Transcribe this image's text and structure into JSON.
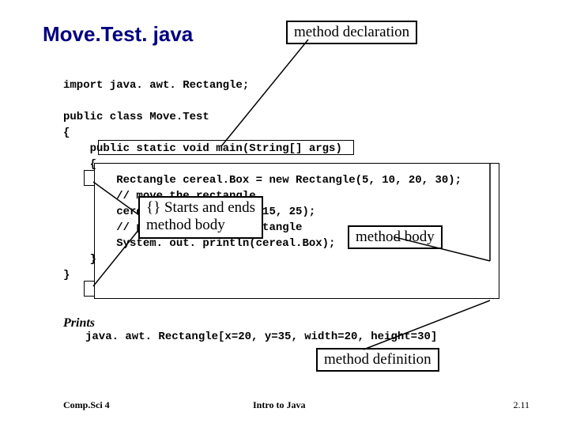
{
  "title": "Move.Test. java",
  "callouts": {
    "decl": "method declaration",
    "starts_line1": "{} Starts and ends",
    "starts_line2": "method body",
    "body": "method body",
    "def": "method definition"
  },
  "code_lines": [
    "import java. awt. Rectangle;",
    "",
    "public class Move.Test",
    "{",
    "    public static void main(String[] args)",
    "    {",
    "        Rectangle cereal.Box = new Rectangle(5, 10, 20, 30);",
    "        // move the rectangle",
    "        cereal.Box. translate(15, 25);",
    "        // print the moved rectangle",
    "        System. out. println(cereal.Box);",
    "    }",
    "}"
  ],
  "output": {
    "label": "Prints",
    "text": "java. awt. Rectangle[x=20, y=35, width=20, height=30]"
  },
  "footer": {
    "left": "Comp.Sci 4",
    "center": "Intro to Java",
    "right": "2.11"
  }
}
